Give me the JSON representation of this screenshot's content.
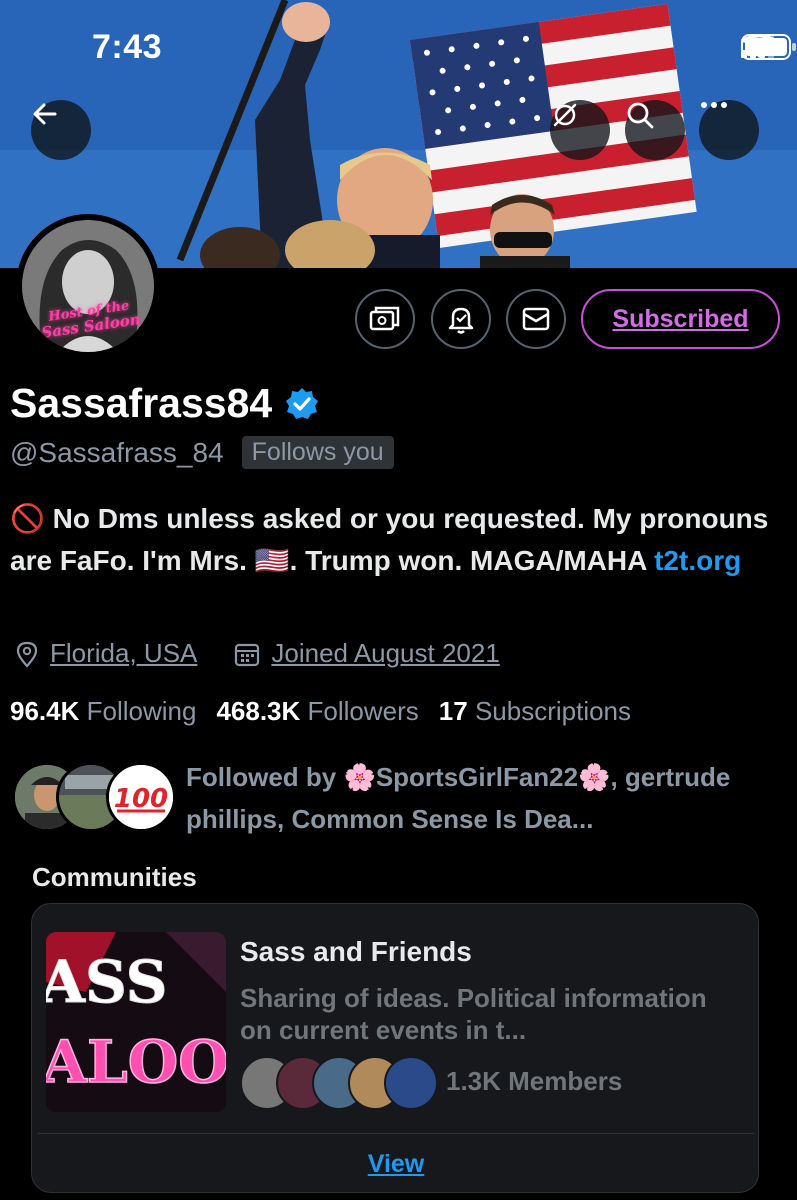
{
  "status_bar": {
    "time": "7:43",
    "icons": [
      "cellular-signal-icon",
      "wifi-icon",
      "battery-icon"
    ]
  },
  "header": {
    "back_icon": "arrow-left-icon",
    "buttons": [
      "translate-off-icon",
      "search-icon",
      "more-icon"
    ]
  },
  "avatar": {
    "caption_line1": "Host of the",
    "caption_line2": "Sass Saloon"
  },
  "actions": {
    "icons": [
      "money-icon",
      "notification-bell-icon",
      "mail-icon"
    ],
    "subscribed_label": "Subscribed"
  },
  "profile": {
    "display_name": "Sassafrass84",
    "verified_icon": "verified-badge-icon",
    "handle": "@Sassafrass_84",
    "follows_you": "Follows you",
    "bio_part1": "🚫 No Dms unless asked or you requested. My pronouns are FaFo. I'm Mrs. 🇺🇸. Trump won. MAGA/MAHA ",
    "bio_link": "t2t.org",
    "location": "Florida, USA",
    "joined": "Joined August 2021"
  },
  "stats": {
    "following_count": "96.4K",
    "following_label": "Following",
    "followers_count": "468.3K",
    "followers_label": "Followers",
    "subscriptions_count": "17",
    "subscriptions_label": "Subscriptions"
  },
  "followed_by": {
    "text": "Followed by 🌸SportsGirlFan22🌸, gertrude phillips, Common Sense Is Dea..."
  },
  "communities": {
    "title": "Communities",
    "card": {
      "image_text_top": "ASS",
      "image_text_bottom": "ALOO",
      "name": "Sass and Friends",
      "description": "Sharing of ideas. Political information on current events in t...",
      "members": "1.3K Members",
      "view_label": "View"
    }
  },
  "colors": {
    "background": "#000000",
    "accent_blue": "#1d9bf0",
    "subscribed_pink": "#c94fdb",
    "muted_text": "#8b98a5"
  }
}
